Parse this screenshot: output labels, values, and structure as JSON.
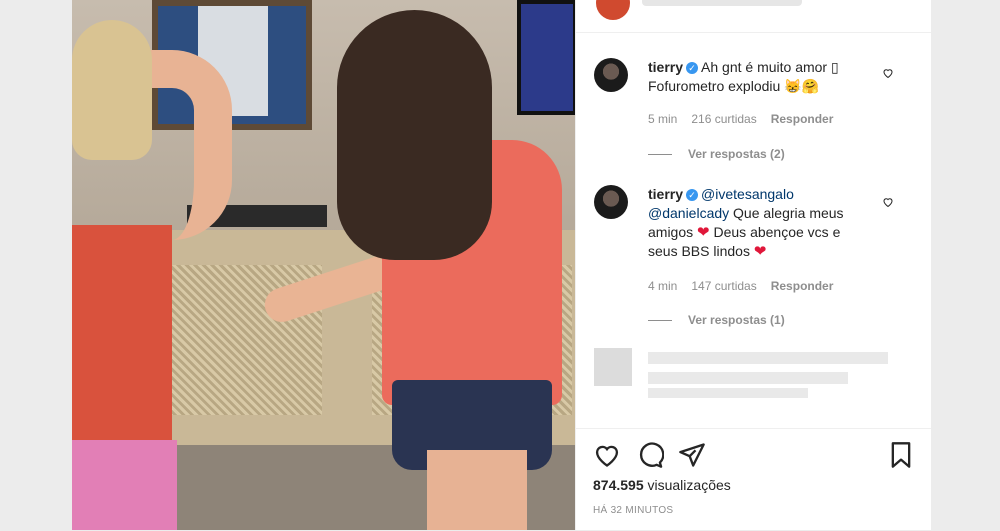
{
  "comments": [
    {
      "username": "tierry",
      "verified_mark": "✓",
      "mention": "",
      "text_line1": "Ah gnt é muito amor",
      "text_tail": "",
      "box_glyph": "▯",
      "text_line2": "Fofurometro explodiu",
      "emojis": "😸🤗",
      "time": "5 min",
      "likes": "216 curtidas",
      "reply_label": "Responder",
      "view_replies": "Ver respostas (2)"
    },
    {
      "username": "tierry",
      "verified_mark": "✓",
      "mention1": "@ivetesangalo",
      "mention2": "@danielcady",
      "text_a": "Que alegria meus amigos",
      "text_b": "Deus abençoe vcs e seus BBS lindos",
      "heart": "❤",
      "time": "4 min",
      "likes": "147 curtidas",
      "reply_label": "Responder",
      "view_replies": "Ver respostas (1)"
    }
  ],
  "post": {
    "views_count": "874.595",
    "views_label": "visualizações",
    "posted": "HÁ 32 MINUTOS"
  },
  "icons": [
    "heart-outline-icon",
    "comment-bubble-icon",
    "share-plane-icon",
    "bookmark-icon"
  ],
  "colors": {
    "verified": "#3897f0",
    "heart": "#e0173a",
    "mention": "#00376b",
    "meta": "#8e8e8e"
  }
}
